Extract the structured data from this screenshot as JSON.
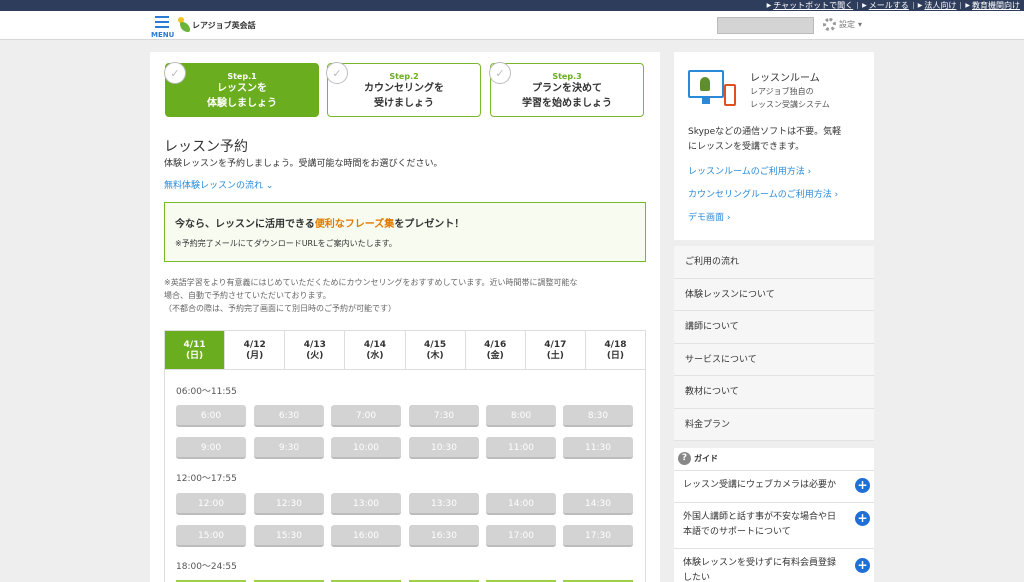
{
  "topbar": {
    "links": [
      "チャットボットで聞く",
      "メールする",
      "法人向け",
      "教育機関向け"
    ]
  },
  "header": {
    "menu_label": "MENU",
    "logo_text": "レアジョブ英会話",
    "settings_label": "設定",
    "settings_caret": "▾"
  },
  "steps": [
    {
      "num": "Step.1",
      "line1": "レッスンを",
      "line2": "体験しましょう"
    },
    {
      "num": "Step.2",
      "line1": "カウンセリングを",
      "line2": "受けましょう"
    },
    {
      "num": "Step.3",
      "line1": "プランを決めて",
      "line2": "学習を始めましょう"
    }
  ],
  "main": {
    "title": "レッスン予約",
    "lead": "体験レッスンを予約しましょう。受講可能な時間をお選びください。",
    "flow_link": "無料体験レッスンの流れ",
    "promo_pre": "今なら、レッスンに活用できる",
    "promo_hl": "便利なフレーズ集",
    "promo_post": "をプレゼント！",
    "promo_note": "※予約完了メールにてダウンロードURLをご案内いたします。",
    "note_line1": "※英語学習をより有意義にはじめていただくためにカウンセリングをおすすめしています。近い時間帯に調整可能な",
    "note_line2": "場合、自動で予約させていただいております。",
    "note_line3": "（不都合の際は、予約完了画面にて別日時のご予約が可能です）"
  },
  "dates": [
    {
      "d": "4/11",
      "w": "(日)"
    },
    {
      "d": "4/12",
      "w": "(月)"
    },
    {
      "d": "4/13",
      "w": "(火)"
    },
    {
      "d": "4/14",
      "w": "(水)"
    },
    {
      "d": "4/15",
      "w": "(木)"
    },
    {
      "d": "4/16",
      "w": "(金)"
    },
    {
      "d": "4/17",
      "w": "(土)"
    },
    {
      "d": "4/18",
      "w": "(日)"
    }
  ],
  "slots": {
    "range1": "06:00〜11:55",
    "range2": "12:00〜17:55",
    "range3": "18:00〜24:55",
    "r1": [
      "6:00",
      "6:30",
      "7:00",
      "7:30",
      "8:00",
      "8:30",
      "9:00",
      "9:30",
      "10:00",
      "10:30",
      "11:00",
      "11:30"
    ],
    "r2": [
      "12:00",
      "12:30",
      "13:00",
      "13:30",
      "14:00",
      "14:30",
      "15:00",
      "15:30",
      "16:00",
      "16:30",
      "17:00",
      "17:30"
    ]
  },
  "sidebar": {
    "title": "レッスンルーム",
    "sub1": "レアジョブ独自の",
    "sub2": "レッスン受講システム",
    "desc1": "Skypeなどの通信ソフトは不要。気軽",
    "desc2": "にレッスンを受講できます。",
    "link1": "レッスンルームのご利用方法",
    "link2": "カウンセリングルームのご利用方法",
    "link3": "デモ画面",
    "menu": [
      "ご利用の流れ",
      "体験レッスンについて",
      "講師について",
      "サービスについて",
      "教材について",
      "料金プラン"
    ],
    "guide_title": "ガイド",
    "guide1": "レッスン受講にウェブカメラは必要か",
    "guide2a": "外国人講師と話す事が不安な場合や日",
    "guide2b": "本語でのサポートについて",
    "guide3a": "体験レッスンを受けずに有料会員登録",
    "guide3b": "したい"
  },
  "colors": {
    "accent_green": "#6aad1f",
    "link_blue": "#2a8ad8",
    "highlight_orange": "#e07a00"
  }
}
